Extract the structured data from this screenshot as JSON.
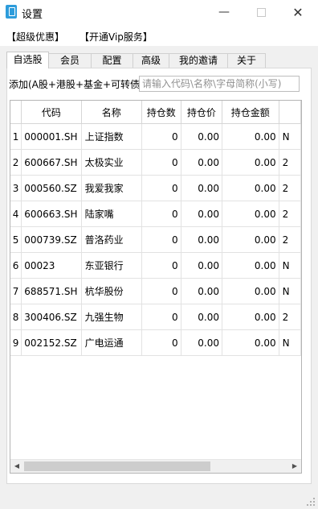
{
  "window": {
    "title": "设置",
    "icon": "app-icon",
    "minimize_glyph": "—",
    "close_glyph": "✕"
  },
  "menu": {
    "items": [
      "【超级优惠】",
      "【开通Vip服务】"
    ]
  },
  "tabs": [
    "自选股",
    "会员",
    "配置",
    "高级",
    "我的邀请",
    "关于"
  ],
  "active_tab": "自选股",
  "add_bar": {
    "label": "添加(A股+港股+基金+可转债)",
    "placeholder": "请输入代码\\名称\\字母简称(小写)",
    "value": ""
  },
  "table": {
    "columns": [
      "",
      "代码",
      "名称",
      "持仓数",
      "持仓价",
      "持仓金额",
      ""
    ],
    "rows": [
      {
        "index": "1",
        "code": "000001.SH",
        "name": "上证指数",
        "qty": "0",
        "price": "0.00",
        "amount": "0.00",
        "extra": "N"
      },
      {
        "index": "2",
        "code": "600667.SH",
        "name": "太极实业",
        "qty": "0",
        "price": "0.00",
        "amount": "0.00",
        "extra": "2"
      },
      {
        "index": "3",
        "code": "000560.SZ",
        "name": "我爱我家",
        "qty": "0",
        "price": "0.00",
        "amount": "0.00",
        "extra": "2"
      },
      {
        "index": "4",
        "code": "600663.SH",
        "name": "陆家嘴",
        "qty": "0",
        "price": "0.00",
        "amount": "0.00",
        "extra": "2"
      },
      {
        "index": "5",
        "code": "000739.SZ",
        "name": "普洛药业",
        "qty": "0",
        "price": "0.00",
        "amount": "0.00",
        "extra": "2"
      },
      {
        "index": "6",
        "code": "00023",
        "name": "东亚银行",
        "qty": "0",
        "price": "0.00",
        "amount": "0.00",
        "extra": "N"
      },
      {
        "index": "7",
        "code": "688571.SH",
        "name": "杭华股份",
        "qty": "0",
        "price": "0.00",
        "amount": "0.00",
        "extra": "N"
      },
      {
        "index": "8",
        "code": "300406.SZ",
        "name": "九强生物",
        "qty": "0",
        "price": "0.00",
        "amount": "0.00",
        "extra": "2"
      },
      {
        "index": "9",
        "code": "002152.SZ",
        "name": "广电运通",
        "qty": "0",
        "price": "0.00",
        "amount": "0.00",
        "extra": "N"
      }
    ]
  },
  "scrollbar": {
    "left_glyph": "◀",
    "right_glyph": "▶"
  },
  "colors": {
    "window_bg": "#f0f0f0",
    "icon_blue": "#2d9cdb",
    "grid_line": "#e2e2e2"
  }
}
